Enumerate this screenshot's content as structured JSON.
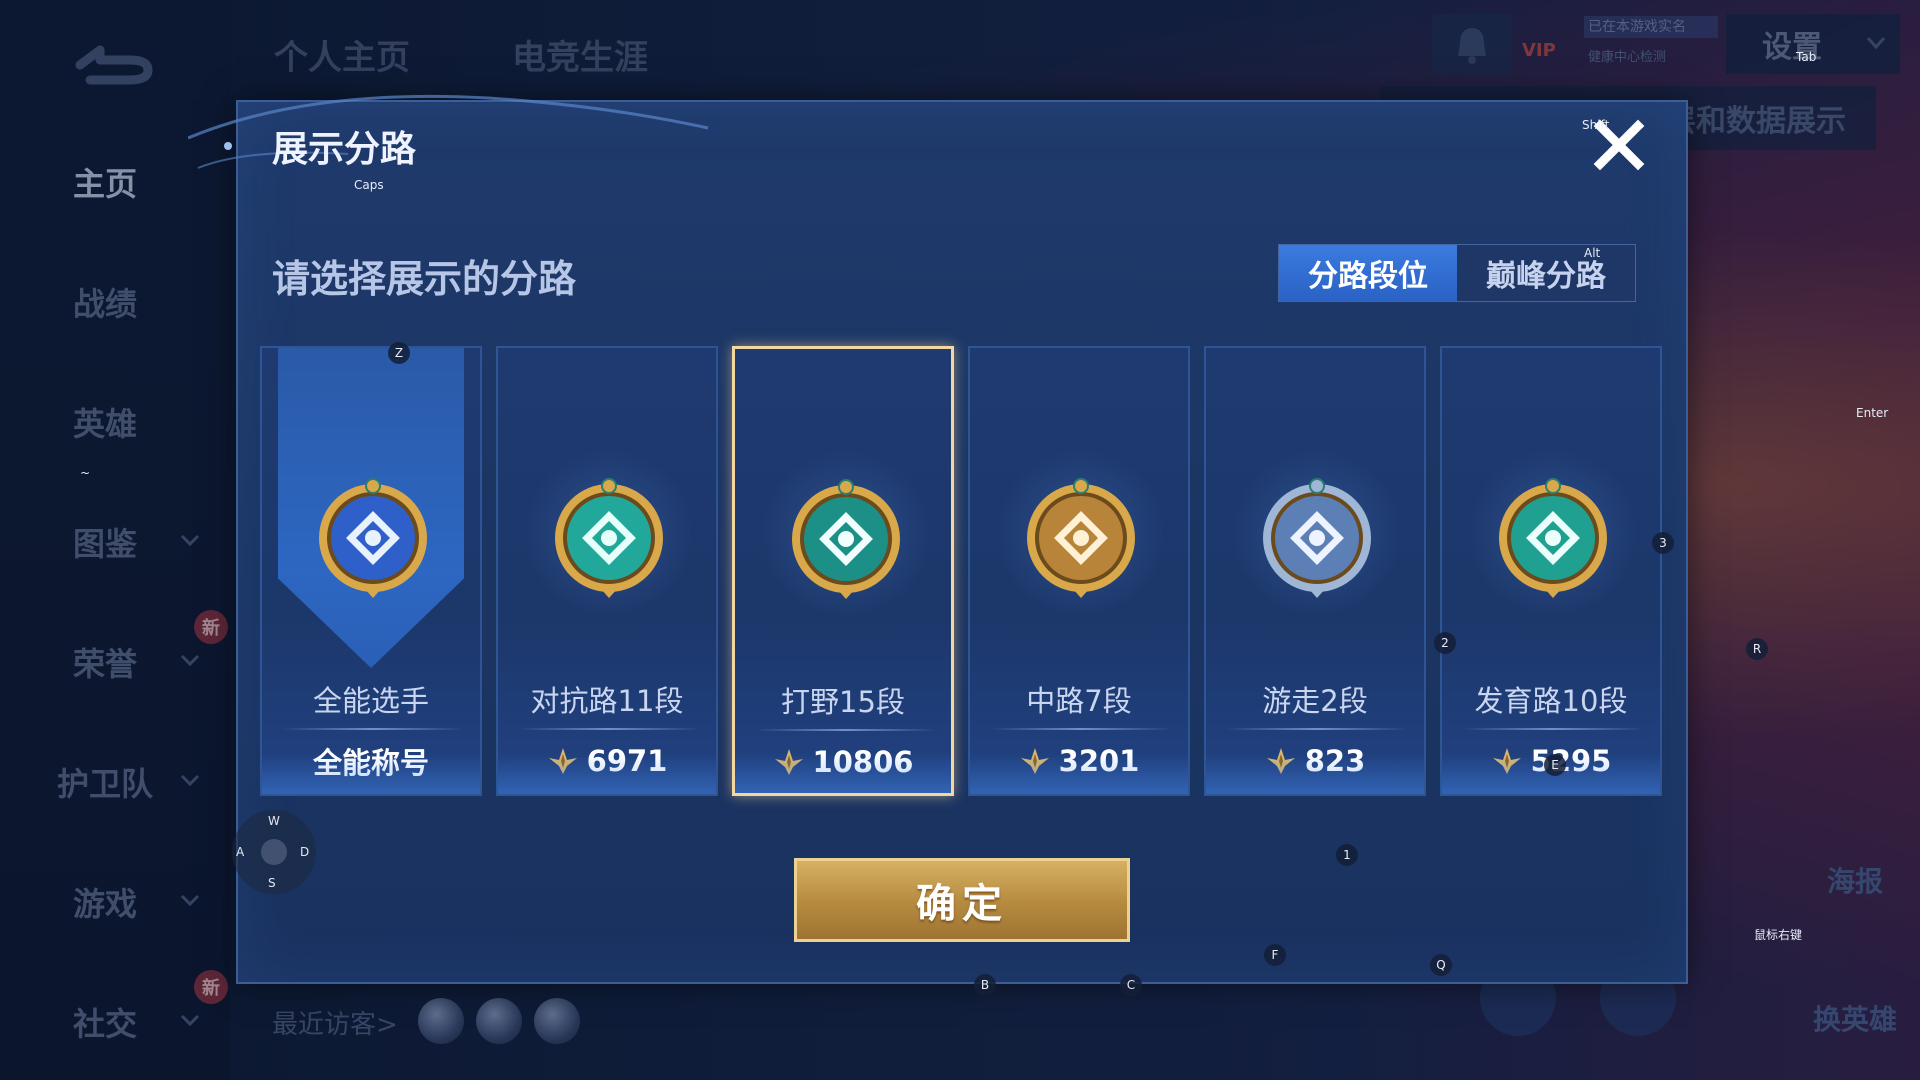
{
  "top_tabs": [
    "个人主页",
    "电竞生涯"
  ],
  "sidebar": {
    "items": [
      {
        "label": "主页",
        "active": true,
        "chevron": false,
        "new": false
      },
      {
        "label": "战绩",
        "active": false,
        "chevron": false,
        "new": false
      },
      {
        "label": "英雄",
        "active": false,
        "chevron": false,
        "new": false
      },
      {
        "label": "图鉴",
        "active": false,
        "chevron": true,
        "new": false
      },
      {
        "label": "荣誉",
        "active": false,
        "chevron": true,
        "new": true
      },
      {
        "label": "护卫队",
        "active": false,
        "chevron": true,
        "new": false
      },
      {
        "label": "游戏",
        "active": false,
        "chevron": true,
        "new": false
      },
      {
        "label": "社交",
        "active": false,
        "chevron": true,
        "new": true
      }
    ],
    "new_badge": "新"
  },
  "header_right": {
    "vip": "VIP",
    "realname_line1": "已在本游戏实名",
    "realname_line2": "健康中心检测",
    "settings": "设置",
    "data_display": "层和数据展示"
  },
  "recent_visitors": "最近访客>",
  "right_panel": {
    "poster": "海报",
    "change_hero": "换英雄"
  },
  "modal": {
    "title": "展示分路",
    "subtitle": "请选择展示的分路",
    "segments": [
      {
        "label": "分路段位",
        "active": true
      },
      {
        "label": "巅峰分路",
        "active": false
      }
    ],
    "cards": [
      {
        "name": "全能选手",
        "score": "全能称号",
        "has_icon": false,
        "selected": false,
        "emblem": "all-round-emblem"
      },
      {
        "name": "对抗路11段",
        "score": "6971",
        "has_icon": true,
        "selected": false,
        "emblem": "clash-lane-emblem"
      },
      {
        "name": "打野15段",
        "score": "10806",
        "has_icon": true,
        "selected": true,
        "emblem": "jungle-emblem"
      },
      {
        "name": "中路7段",
        "score": "3201",
        "has_icon": true,
        "selected": false,
        "emblem": "mid-lane-emblem"
      },
      {
        "name": "游走2段",
        "score": "823",
        "has_icon": true,
        "selected": false,
        "emblem": "roam-emblem"
      },
      {
        "name": "发育路10段",
        "score": "5295",
        "has_icon": true,
        "selected": false,
        "emblem": "farm-lane-emblem"
      }
    ],
    "confirm": "确定"
  },
  "key_hints": {
    "caps": "Caps",
    "shift": "Shift",
    "tab": "Tab",
    "alt": "Alt",
    "enter": "Enter",
    "z": "Z",
    "three": "3",
    "two": "2",
    "r": "R",
    "one": "1",
    "f": "F",
    "q": "Q",
    "b": "B",
    "c": "C",
    "e": "E",
    "tilde": "~",
    "mouse_right": "鼠标右键",
    "w": "W",
    "a": "A",
    "s": "S",
    "d": "D"
  },
  "colors": {
    "accent_blue": "#2a62c4",
    "gold": "#d6b064",
    "selected_border": "#f3d6a0"
  }
}
